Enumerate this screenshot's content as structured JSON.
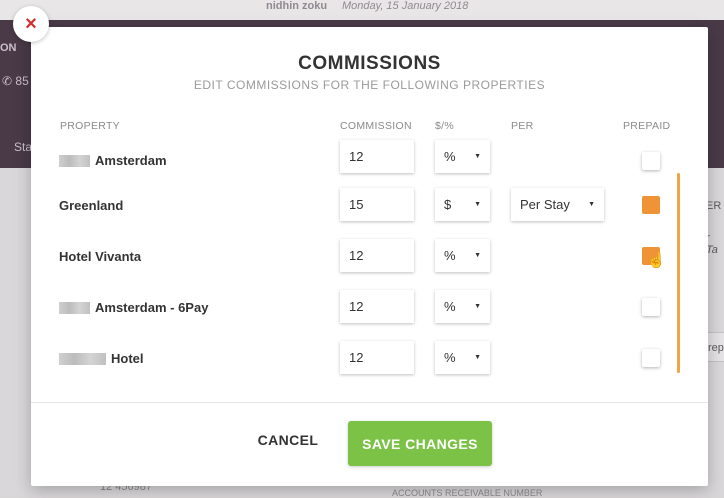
{
  "background": {
    "user_name": "nidhin zoku",
    "date": "Monday, 15 January 2018",
    "header_fragment": "ON",
    "phone_fragment": "85",
    "tab_fragment": "Sta",
    "side_fragment_1": "ER",
    "side_fragment_2": "r Ta",
    "side_fragment_3": "rep",
    "number_fragment": "12 456987",
    "account_fragment": "ACCOUNTS RECEIVABLE NUMBER"
  },
  "modal": {
    "close_glyph": "×",
    "title": "COMMISSIONS",
    "subtitle": "EDIT COMMISSIONS FOR THE FOLLOWING PROPERTIES",
    "columns": {
      "property": "PROPERTY",
      "commission": "COMMISSION",
      "unit": "$/%",
      "per": "PER",
      "prepaid": "PREPAID"
    },
    "rows": [
      {
        "name": "Amsterdam",
        "commission": "12",
        "unit": "%",
        "per": "",
        "prepaid": false
      },
      {
        "name": "Greenland",
        "commission": "15",
        "unit": "$",
        "per": "Per Stay",
        "prepaid": true
      },
      {
        "name": "Hotel Vivanta",
        "commission": "12",
        "unit": "%",
        "per": "",
        "prepaid": true
      },
      {
        "name": "Amsterdam - 6Pay",
        "commission": "12",
        "unit": "%",
        "per": "",
        "prepaid": false
      },
      {
        "name": "Hotel",
        "commission": "12",
        "unit": "%",
        "per": "",
        "prepaid": false
      }
    ],
    "caret_glyph": "▼",
    "cancel_label": "CANCEL",
    "save_label": "SAVE CHANGES"
  },
  "colors": {
    "accent_orange": "#ef9337",
    "save_green": "#7cc246",
    "close_red": "#d42d2d",
    "header_purple": "#4a3a48"
  }
}
